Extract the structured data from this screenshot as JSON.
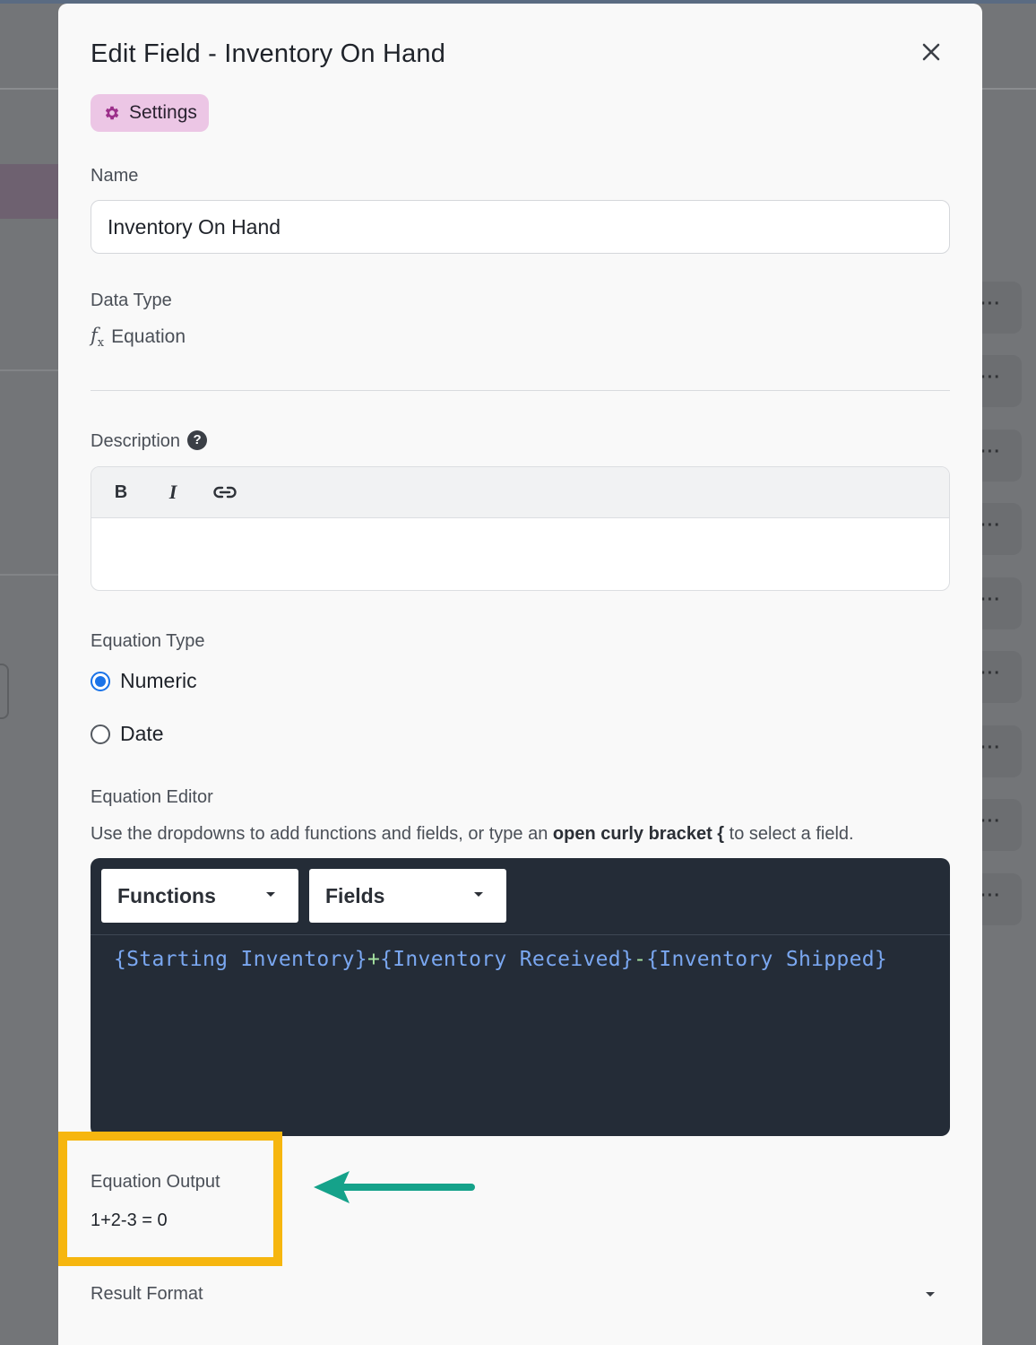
{
  "modal": {
    "title": "Edit Field - Inventory On Hand",
    "close_icon": "close-icon",
    "settings_tab": {
      "label": "Settings",
      "icon": "gear-icon",
      "color": "#ecc6e5"
    }
  },
  "name_field": {
    "label": "Name",
    "value": "Inventory On Hand"
  },
  "data_type": {
    "label": "Data Type",
    "icon": "fx-icon",
    "value": "Equation"
  },
  "description": {
    "label": "Description",
    "help_icon": "question-circle-icon",
    "toolbar": [
      {
        "name": "bold",
        "glyph": "B"
      },
      {
        "name": "italic",
        "glyph": "I"
      },
      {
        "name": "link",
        "icon": "link-icon"
      }
    ],
    "value": ""
  },
  "equation_type": {
    "label": "Equation Type",
    "options": [
      {
        "label": "Numeric",
        "selected": true
      },
      {
        "label": "Date",
        "selected": false
      }
    ],
    "accent": "#1a73e8"
  },
  "equation_editor": {
    "label": "Equation Editor",
    "hint_prefix": "Use the dropdowns to add functions and fields, or type an ",
    "hint_bold": "open curly bracket {",
    "hint_suffix": " to select a field.",
    "functions_dropdown": "Functions",
    "fields_dropdown": "Fields",
    "code": [
      {
        "text": "{Starting Inventory}",
        "kind": "field"
      },
      {
        "text": "+",
        "kind": "op"
      },
      {
        "text": "{Inventory Received}",
        "kind": "field"
      },
      {
        "text": "-",
        "kind": "op"
      },
      {
        "text": "{Inventory Shipped}",
        "kind": "field"
      }
    ],
    "background": "#242c37"
  },
  "equation_output": {
    "label": "Equation Output",
    "value": "1+2-3 = 0",
    "highlight_color": "#f6b60f"
  },
  "annotation": {
    "arrow_color": "#15a28a"
  },
  "result_format": {
    "label": "Result Format"
  }
}
